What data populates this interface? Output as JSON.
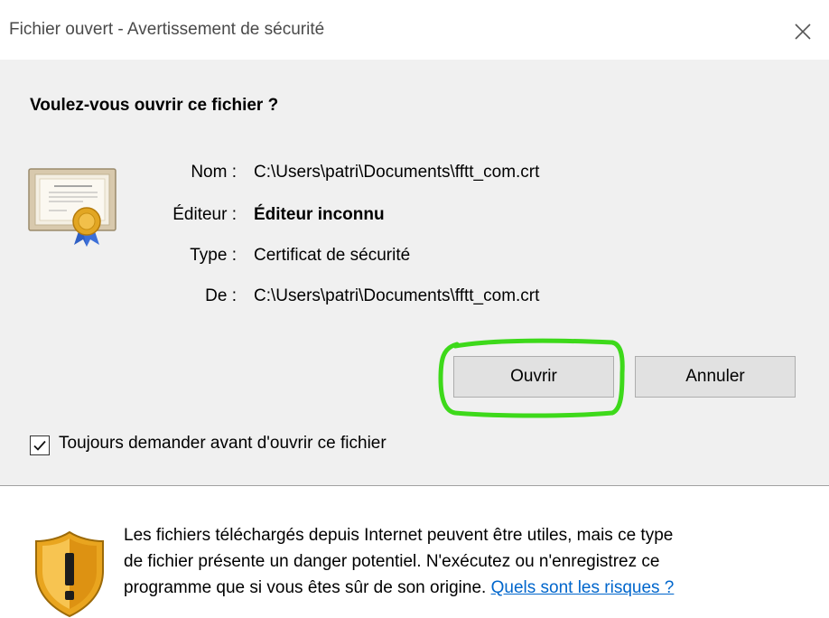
{
  "window": {
    "title": "Fichier ouvert - Avertissement de sécurité"
  },
  "dialog": {
    "question": "Voulez-vous ouvrir ce fichier ?",
    "fields": {
      "name_label": "Nom :",
      "name_value": "C:\\Users\\patri\\Documents\\fftt_com.crt",
      "publisher_label": "Éditeur :",
      "publisher_value": "Éditeur inconnu",
      "type_label": "Type :",
      "type_value": "Certificat de sécurité",
      "from_label": "De :",
      "from_value": "C:\\Users\\patri\\Documents\\fftt_com.crt"
    },
    "buttons": {
      "open_label": "Ouvrir",
      "cancel_label": "Annuler"
    },
    "checkbox": {
      "label": "Toujours demander avant d'ouvrir ce fichier",
      "checked": true
    }
  },
  "footer": {
    "warning_line1": "Les fichiers téléchargés depuis Internet peuvent être utiles, mais ce type",
    "warning_line2": "de fichier présente un danger potentiel. N'exécutez ou n'enregistrez ce",
    "warning_line3": "programme que si vous êtes sûr de son origine.",
    "risk_link": "Quels sont les risques ?"
  },
  "colors": {
    "highlight_annotation": "#3dd91a",
    "link": "#0066cc",
    "dialog_background": "#f0f0f0",
    "button_face": "#e1e1e1"
  },
  "icons": {
    "close": "close-icon",
    "certificate": "certificate-icon",
    "shield": "shield-warning-icon",
    "checkmark": "checkmark-icon"
  }
}
